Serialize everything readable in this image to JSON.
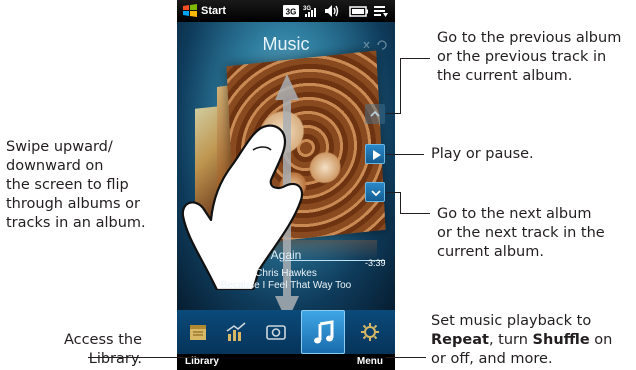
{
  "status_bar": {
    "start_label": "Start",
    "icons": [
      "windows-flag-icon",
      "3g-icon",
      "signal-icon",
      "volume-icon",
      "battery-icon",
      "connectivity-icon"
    ]
  },
  "player": {
    "title": "Music",
    "album_name": "Again",
    "time_remaining": "-3:39",
    "artist": "Chris Hawkes",
    "track_title": "Because I Feel That Way Too",
    "controls": [
      "previous-album-icon",
      "play-pause-icon",
      "next-album-icon"
    ]
  },
  "tabs": [
    "calendar-icon",
    "stocks-icon",
    "photos-icon",
    "music-icon",
    "settings-icon"
  ],
  "softkeys": {
    "left": "Library",
    "right": "Menu"
  },
  "callouts": {
    "previous": [
      "Go to the previous album",
      "or the previous track in",
      "the current album."
    ],
    "play": "Play or pause.",
    "next": [
      "Go to the next album",
      "or the next track in the",
      "current album."
    ],
    "swipe": [
      "Swipe upward/",
      "downward on",
      "the screen to flip",
      "through albums or",
      "tracks in an album."
    ],
    "library": [
      "Access the",
      "Library."
    ],
    "menu": {
      "line1": "Set music playback to",
      "repeat_bold": "Repeat",
      "line2_mid": ", turn ",
      "shuffle_bold": "Shuffle",
      "line2_end": " on",
      "line3": "or off, and more."
    }
  },
  "colors": {
    "accent": "#1a6cac",
    "screen_bg": "#0f3c5c",
    "text": "#231f20"
  }
}
